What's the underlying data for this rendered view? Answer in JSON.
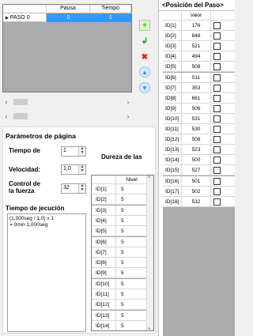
{
  "steps": {
    "columns": [
      "Pausa",
      "Tiempo"
    ],
    "rows": [
      {
        "label": "PASO 0",
        "pausa": "0",
        "tiempo": "1"
      }
    ]
  },
  "toolbar": {
    "add_icon": "plus-icon",
    "redo_icon": "return-arrow-icon",
    "delete_icon": "delete-x-icon",
    "up_icon": "arrow-up-icon",
    "down_icon": "arrow-down-icon"
  },
  "params": {
    "title": "Parámetros de página",
    "tiempo_label": "Tiempo de",
    "tiempo_value": "1",
    "velocidad_label": "Velocidad:",
    "velocidad_value": "1,0",
    "control_label_1": "Control de",
    "control_label_2": "la fuerza",
    "control_value": "32",
    "ejecucion_title": "Tiempo de jecución",
    "ejecucion_line1": "(1,000seg / 1,0) x 1",
    "ejecucion_line2": "= 0min 1,000seg"
  },
  "dureza": {
    "title": "Dureza de las",
    "column": "Nivel",
    "rows": [
      {
        "id": "ID[1]",
        "nivel": "5"
      },
      {
        "id": "ID[2]",
        "nivel": "5"
      },
      {
        "id": "ID[3]",
        "nivel": "5"
      },
      {
        "id": "ID[4]",
        "nivel": "5"
      },
      {
        "id": "ID[5]",
        "nivel": "5"
      },
      {
        "id": "ID[6]",
        "nivel": "5"
      },
      {
        "id": "ID[7]",
        "nivel": "5"
      },
      {
        "id": "ID[8]",
        "nivel": "5"
      },
      {
        "id": "ID[9]",
        "nivel": "5"
      },
      {
        "id": "ID[10]",
        "nivel": "5"
      },
      {
        "id": "ID[11]",
        "nivel": "5"
      },
      {
        "id": "ID[12]",
        "nivel": "5"
      },
      {
        "id": "ID[13]",
        "nivel": "5"
      },
      {
        "id": "ID[14]",
        "nivel": "5"
      }
    ]
  },
  "posicion": {
    "title": "<Posición del Paso>",
    "column": "Valor",
    "rows": [
      {
        "id": "ID[1]",
        "valor": "176"
      },
      {
        "id": "ID[2]",
        "valor": "848"
      },
      {
        "id": "ID[3]",
        "valor": "521"
      },
      {
        "id": "ID[4]",
        "valor": "494"
      },
      {
        "id": "ID[5]",
        "valor": "508"
      },
      {
        "id": "ID[6]",
        "valor": "511"
      },
      {
        "id": "ID[7]",
        "valor": "353"
      },
      {
        "id": "ID[8]",
        "valor": "661"
      },
      {
        "id": "ID[9]",
        "valor": "506"
      },
      {
        "id": "ID[10]",
        "valor": "531"
      },
      {
        "id": "ID[11]",
        "valor": "530"
      },
      {
        "id": "ID[12]",
        "valor": "508"
      },
      {
        "id": "ID[13]",
        "valor": "523"
      },
      {
        "id": "ID[14]",
        "valor": "500"
      },
      {
        "id": "ID[15]",
        "valor": "527"
      },
      {
        "id": "ID[16]",
        "valor": "501"
      },
      {
        "id": "ID[17]",
        "valor": "502"
      },
      {
        "id": "ID[18]",
        "valor": "532"
      }
    ]
  },
  "colors": {
    "selection": "#3399ff",
    "grid_bg": "#ababab"
  }
}
